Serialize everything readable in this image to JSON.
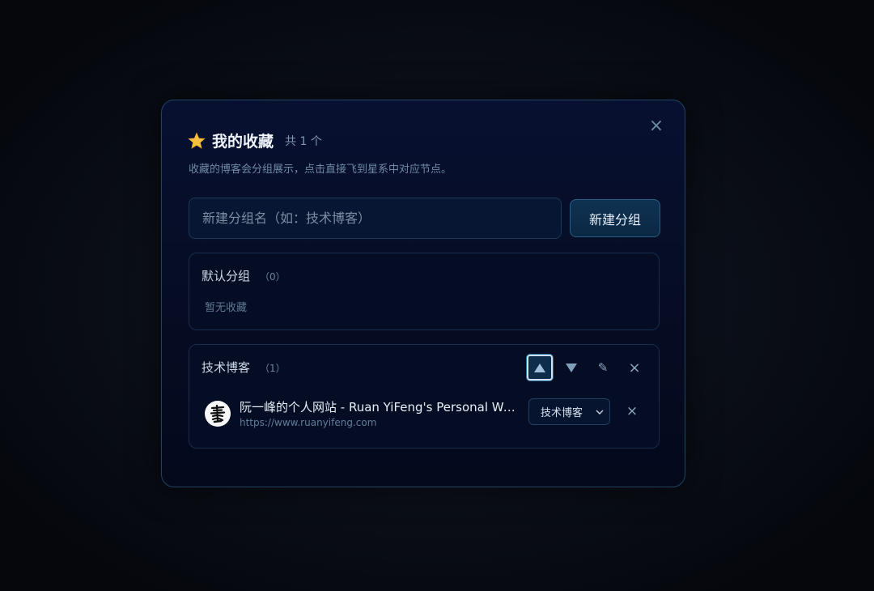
{
  "modal": {
    "title": "我的收藏",
    "count_label": "共 1 个",
    "subtitle": "收藏的博客会分组展示，点击直接飞到星系中对应节点。",
    "close_icon": "×"
  },
  "new_group": {
    "input_value": "",
    "placeholder": "新建分组名（如：技术博客）",
    "button_label": "新建分组"
  },
  "groups": [
    {
      "name": "默认分组",
      "count": "（0）",
      "empty_text": "暂无收藏"
    },
    {
      "name": "技术博客",
      "count": "（1）",
      "actions": {
        "move_up": "move-up-icon",
        "move_down": "move-down-icon",
        "rename": "✎",
        "delete": "×"
      },
      "items": [
        {
          "title": "阮一峰的个人网站 - Ruan YiFeng's Personal Website",
          "url": "https://www.ruanyifeng.com",
          "group": "技术博客",
          "remove": "×"
        }
      ]
    }
  ],
  "colors": {
    "accent": "#2b5d84",
    "border": "#1f4563",
    "background": "#050c22"
  }
}
